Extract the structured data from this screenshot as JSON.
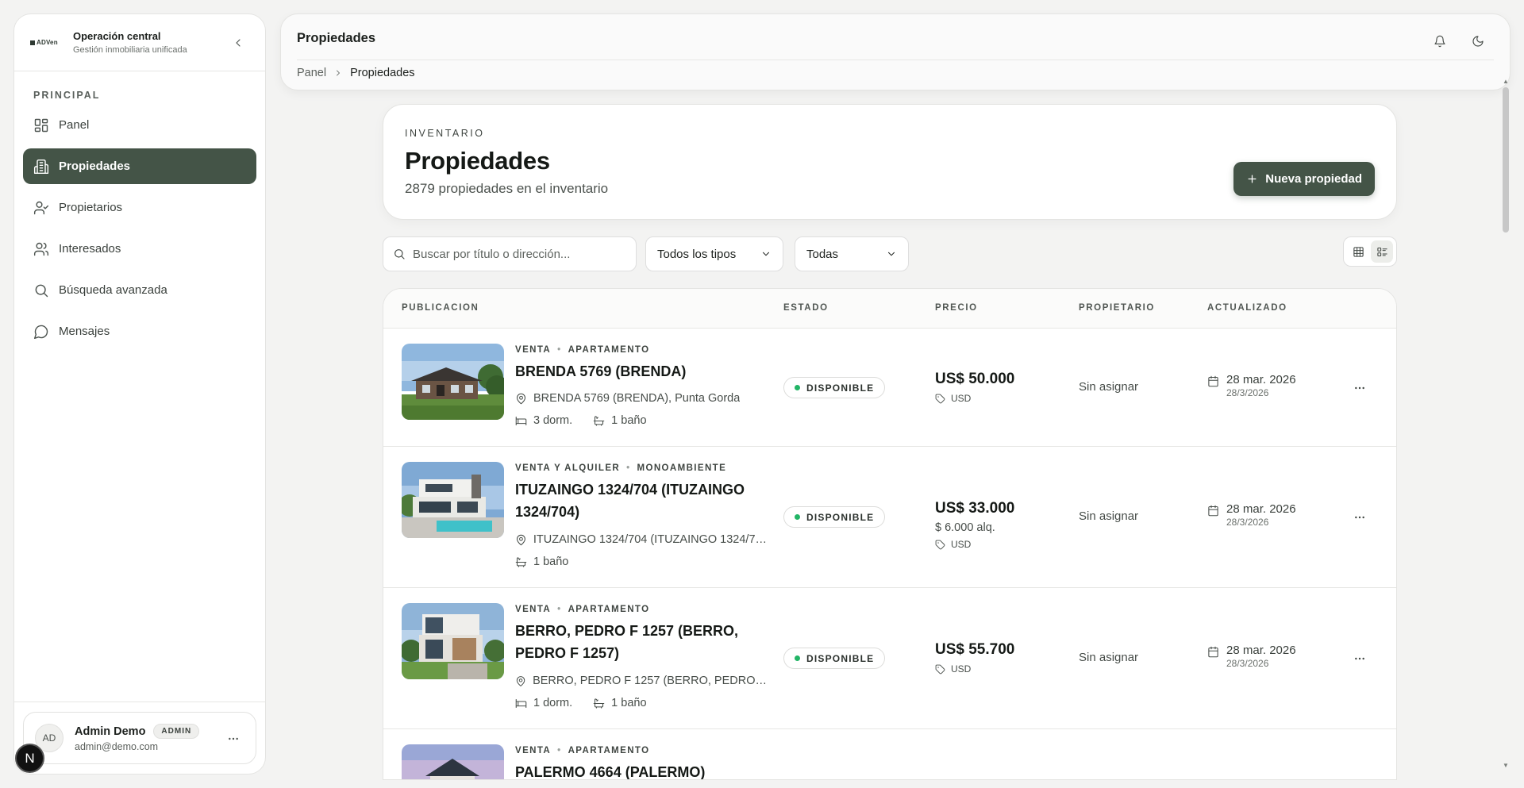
{
  "sidebar": {
    "logo": "ADVen",
    "title": "Operación central",
    "subtitle": "Gestión inmobiliaria unificada",
    "section": "PRINCIPAL",
    "items": [
      {
        "label": "Panel",
        "icon": "dashboard-icon"
      },
      {
        "label": "Propiedades",
        "icon": "building-icon",
        "active": true
      },
      {
        "label": "Propietarios",
        "icon": "user-check-icon"
      },
      {
        "label": "Interesados",
        "icon": "users-icon"
      },
      {
        "label": "Búsqueda avanzada",
        "icon": "search-icon"
      },
      {
        "label": "Mensajes",
        "icon": "message-icon"
      }
    ],
    "user": {
      "initials": "AD",
      "name": "Admin Demo",
      "role": "ADMIN",
      "email": "admin@demo.com"
    },
    "dev_badge": "N"
  },
  "topbar": {
    "title": "Propiedades",
    "breadcrumb": [
      "Panel",
      "Propiedades"
    ]
  },
  "hero": {
    "eyebrow": "INVENTARIO",
    "title": "Propiedades",
    "subtitle": "2879 propiedades en el inventario",
    "new_button": "Nueva propiedad"
  },
  "filters": {
    "search_placeholder": "Buscar por título o dirección...",
    "type_select": "Todos los tipos",
    "status_select": "Todas"
  },
  "table": {
    "columns": [
      "PUBLICACION",
      "ESTADO",
      "PRECIO",
      "PROPIETARIO",
      "ACTUALIZADO"
    ],
    "rows": [
      {
        "operation": "VENTA",
        "kind": "APARTAMENTO",
        "title": "BRENDA 5769 (BRENDA)",
        "address": "BRENDA 5769 (BRENDA), Punta Gorda",
        "bedrooms": "3 dorm.",
        "bathrooms": "1 baño",
        "status": "DISPONIBLE",
        "price": "US$ 50.000",
        "rent": "",
        "currency": "USD",
        "owner": "Sin asignar",
        "updated": "28 mar. 2026",
        "updated_short": "28/3/2026"
      },
      {
        "operation": "VENTA Y ALQUILER",
        "kind": "MONOAMBIENTE",
        "title": "ITUZAINGO 1324/704 (ITUZAINGO 1324/704)",
        "address": "ITUZAINGO 1324/704 (ITUZAINGO 1324/70...",
        "bedrooms": "",
        "bathrooms": "1 baño",
        "status": "DISPONIBLE",
        "price": "US$ 33.000",
        "rent": "$ 6.000 alq.",
        "currency": "USD",
        "owner": "Sin asignar",
        "updated": "28 mar. 2026",
        "updated_short": "28/3/2026"
      },
      {
        "operation": "VENTA",
        "kind": "APARTAMENTO",
        "title": "BERRO, PEDRO F 1257 (BERRO, PEDRO F 1257)",
        "address": "BERRO, PEDRO F 1257 (BERRO, PEDRO F 1...",
        "bedrooms": "1 dorm.",
        "bathrooms": "1 baño",
        "status": "DISPONIBLE",
        "price": "US$ 55.700",
        "rent": "",
        "currency": "USD",
        "owner": "Sin asignar",
        "updated": "28 mar. 2026",
        "updated_short": "28/3/2026"
      },
      {
        "operation": "VENTA",
        "kind": "APARTAMENTO",
        "title": "PALERMO 4664 (PALERMO)"
      }
    ]
  },
  "colors": {
    "accent": "#445447",
    "status_available": "#22b566",
    "background": "#f3f3f2"
  }
}
